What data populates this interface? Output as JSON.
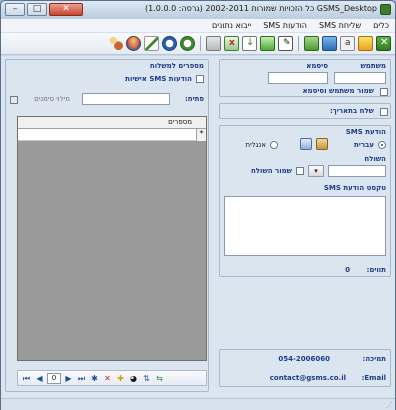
{
  "window": {
    "title": "GSMS_Desktop כל הזכויות שמורות 2002-2011 (גרסה: 1.0.0.0)",
    "controls": {
      "minimize": "–",
      "maximize": "□",
      "close": "✕"
    }
  },
  "menu": [
    "ייבוא נתונים",
    "הודעות SMS",
    "שליחת SMS",
    "כלים"
  ],
  "toolbar": {
    "icons": [
      "exit-icon",
      "settings-icon",
      "text-icon",
      "edit-icon",
      "contacts-icon",
      "schedule-icon",
      "export-icon",
      "import-icon",
      "excel-icon",
      "card-icon",
      "clock-icon",
      "history-icon",
      "pen-icon",
      "database-icon",
      "users-icon"
    ]
  },
  "account": {
    "username_label": "משתמש",
    "password_label": "סיסמא",
    "save_label": "שמור משתמש וסיסמא",
    "send_on_date_label": "שלח בתאריך:"
  },
  "sms": {
    "section_label": "הודעת SMS",
    "hebrew_label": "עברית",
    "english_label": "אנגלית",
    "sender_label": "השולח",
    "save_sender_label": "שמור השולח",
    "text_label": "טקסט הודעת SMS",
    "chars_label": "תווים:",
    "chars_value": "0"
  },
  "support": {
    "phone_label": "תמיכה:",
    "phone_value": "054-2006060",
    "email_label": "Email:",
    "email_value": "contact@gsms.co.il"
  },
  "recipients": {
    "section_label": "מספרים למשלוח",
    "personal_label": "הודעות SMS אישיות",
    "prefix_label": "פתיח:",
    "fill_sig_label": "מילוי סימנים",
    "grid_header": "מספרים",
    "new_row_marker": "*",
    "nav": {
      "first": "⏮",
      "prev": "◀",
      "position": "0",
      "next": "▶",
      "last": "⏭",
      "new": "✱",
      "delete": "✕",
      "add": "✚"
    }
  },
  "colors": {
    "accent_label": "#1f3a8a",
    "window_bg": "#dbe5ef",
    "grid_bg": "#9a9a9a"
  }
}
